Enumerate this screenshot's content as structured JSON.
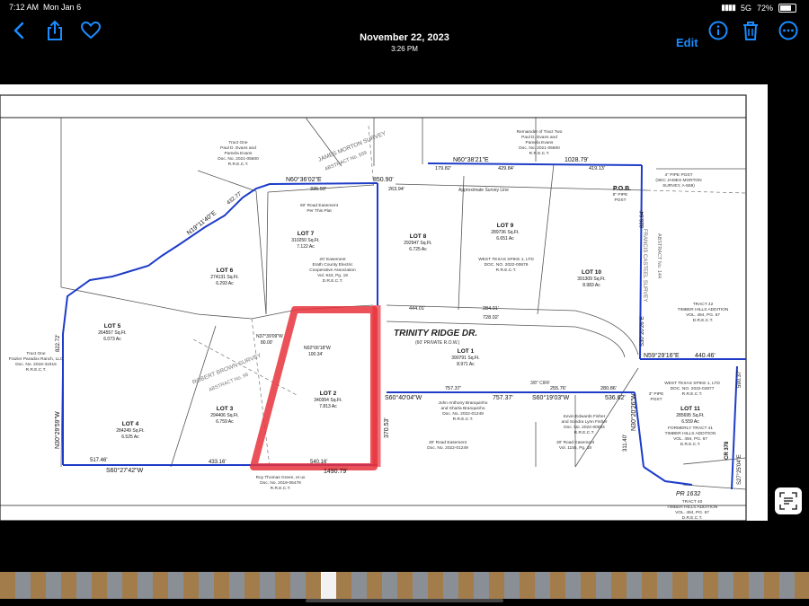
{
  "status_bar": {
    "time": "7:12 AM",
    "day": "Mon Jan 6",
    "network": "5G",
    "battery": "72%",
    "battery_level": 0.72
  },
  "header": {
    "date": "November 22, 2023",
    "time": "3:26 PM",
    "edit_label": "Edit"
  },
  "icons": {
    "back": "chevron-left-icon",
    "share": "share-icon",
    "favorite": "heart-icon",
    "info": "info-icon",
    "delete": "trash-icon",
    "more": "more-icon",
    "scan": "live-text-icon"
  },
  "colors": {
    "accent": "#1a8cff",
    "boundary": "#1e3cc8",
    "highlight": "#e8323c"
  },
  "plat": {
    "survey1": "JAMES MORTON SURVEY",
    "survey1_abs": "ABSTRACT No. 559",
    "survey2": "ROBERT BROWN SURVEY",
    "survey2_abs": "ABSTRACT No. 98",
    "survey3": "FRANCIS CASTEEL SURVEY",
    "survey3_abs": "ABSTRACT No. 144",
    "road": "TRINITY RIDGE DR.",
    "road_sub": "(60' PRIVATE R.O.W.)",
    "pr": "PR 1632",
    "cr": "CR 378",
    "pob": "P.O.B.",
    "bearings": {
      "b1": "N60°38'21\"E",
      "b1d": "1028.79'",
      "b2": "N60°36'02\"E",
      "b2d": "850.90'",
      "b3": "S60°27'42\"W",
      "b3d": "1490.79'",
      "b4": "S60°40'04\"W",
      "b4d": "757.37'",
      "b5": "S60°19'03\"W",
      "b5d": "536.62'",
      "b6": "N59°29'16\"E",
      "b6d": "440.46'",
      "b7": "N30°20'26\"W",
      "b7d": "311.40'",
      "b8": "N19°11'40\"E",
      "b8d": "432.77'",
      "b9": "N30°29'59\"W",
      "b9d": "822.72'",
      "b10": "S60°27'42\"W",
      "b11": "N02°06'18\"W",
      "b11d": "100.34'",
      "b12": "N37°39'09\"W",
      "b12d": "80.00'",
      "b13": "S30°20'26\"E",
      "b13d": "826.64'",
      "b14": "S27°25'04\"E",
      "b14d": "590.37'",
      "d1": "370.53'",
      "d2": "517.46'",
      "d3": "433.16'",
      "d4": "540.16'",
      "d5": "179.82'",
      "d6": "429.84'",
      "d7": "419.13'",
      "d8": "444.01'",
      "d9": "284.01'",
      "d10": "728.02'",
      "d11": "335.93'",
      "d12": "263.94'",
      "d13": "757.37'",
      "d14": "255.76'",
      "d15": "280.86'"
    },
    "lots": [
      {
        "name": "LOT 1",
        "sqft": "390791 Sq.Ft.",
        "ac": "8.971 Ac"
      },
      {
        "name": "LOT 2",
        "sqft": "340354 Sq.Ft.",
        "ac": "7.813 Ac"
      },
      {
        "name": "LOT 3",
        "sqft": "294406 Sq.Ft.",
        "ac": "6.759 Ac"
      },
      {
        "name": "LOT 4",
        "sqft": "284249 Sq.Ft.",
        "ac": "6.525 Ac"
      },
      {
        "name": "LOT 5",
        "sqft": "264557 Sq.Ft.",
        "ac": "6.073 Ac"
      },
      {
        "name": "LOT 6",
        "sqft": "274131 Sq.Ft.",
        "ac": "6.293 Ac"
      },
      {
        "name": "LOT 7",
        "sqft": "310250 Sq.Ft.",
        "ac": "7.122 Ac"
      },
      {
        "name": "LOT 8",
        "sqft": "292947 Sq.Ft.",
        "ac": "6.725 Ac"
      },
      {
        "name": "LOT 9",
        "sqft": "289736 Sq.Ft.",
        "ac": "6.651 Ac"
      },
      {
        "name": "LOT 10",
        "sqft": "391309 Sq.Ft.",
        "ac": "8.983 Ac"
      },
      {
        "name": "LOT 11",
        "sqft": "285695 Sq.Ft.",
        "ac": "6.559 Ac"
      }
    ],
    "notes": {
      "tract_one": [
        "Tract One",
        "Paul D. Evans and",
        "Pamela Evans",
        "Doc. No. 2021-05600",
        "R.R.E.C.T."
      ],
      "remainder": [
        "Remainder of Tract Two",
        "Paul D. Evans and",
        "Pamela Evans",
        "Doc. No. 2021-05600",
        "R.R.E.C.T."
      ],
      "pipe_post": [
        "4\" PIPE POST",
        "(SEC JAMES MORTON",
        "SURVEY, A-559)"
      ],
      "pipe_post8": [
        "8\" PIPE",
        "POST"
      ],
      "road_easement": [
        "60' Road Easement",
        "Per This Plat"
      ],
      "erath": [
        "20' Easement",
        "Erath County Electric",
        "Cooperative Association",
        "Vol. 943, Pg. 19",
        "D.R.E.C.T."
      ],
      "wtx": [
        "WEST TEXAS SPIKE 1, LTD",
        "DOC. NO. 2022-00679",
        "R.R.E.C.T."
      ],
      "tract42": [
        "TRACT 42",
        "TIMBER HILLS ADDITION",
        "VOL. 494, PG. 67",
        "D.R.E.C.T."
      ],
      "tract40": [
        "TRACT 40",
        "TIMBER HILLS ADDITION",
        "VOL. 494, PG. 67",
        "D.R.E.C.T."
      ],
      "tract41": [
        "FORMERLY TRACT 41",
        "TIMBER HILLS ADDITION",
        "VOL. 494, PG. 67",
        "D.R.E.C.T."
      ],
      "wtx2": [
        "WEST TEXAS SPIKE 1, LTD",
        "DOC. NO. 2022-02877",
        "R.R.E.C.T."
      ],
      "branquinho": [
        "John Anthony Branquinho",
        "and Sharla Branquinho",
        "Doc. No. 2022-01249",
        "R.R.E.C.T."
      ],
      "fisher": [
        "Kevin Edwards Fisher",
        "and Sondra Lynn Fisher",
        "Doc. No. 2022-00084",
        "R.R.E.C.T."
      ],
      "green": [
        "Roy Thomas Green, et ux",
        "Doc. No. 2019-06478",
        "R.R.E.C.T."
      ],
      "paradox": [
        "Tract One",
        "Frazier Paradox Ranch, LLC",
        "Doc. No. 2018-31915",
        "R.R.E.C.T."
      ],
      "easement30": [
        "30' Road Easement",
        "Doc. No. 2022-01249"
      ],
      "easement30b": [
        "30' Road Easement",
        "Vol. 1155, Pg. 18"
      ],
      "survey_line": "Approximate Survey Line",
      "cirf": "3/8\" CIRF",
      "pipe_post2": [
        "3\" PIPE",
        "POST"
      ]
    }
  }
}
